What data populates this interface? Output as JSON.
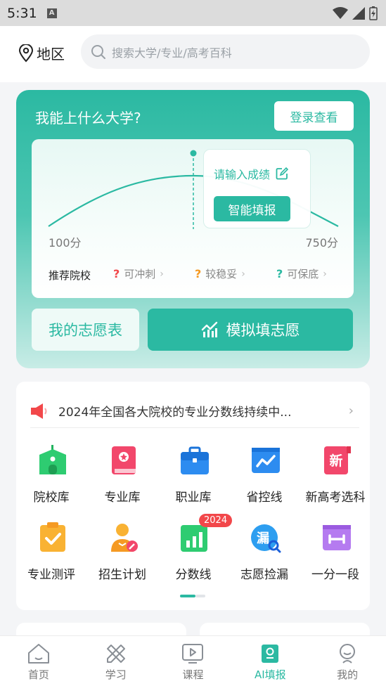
{
  "status_bar": {
    "time": "5:31",
    "notif_letter": "A"
  },
  "header": {
    "region_label": "地区",
    "search_placeholder": "搜索大学/专业/高考百科"
  },
  "hero": {
    "title": "我能上什么大学?",
    "login_label": "登录查看",
    "score_min": "100分",
    "score_max": "750分",
    "popup_prompt": "请输入成绩",
    "popup_button": "智能填报",
    "recommend_label": "推荐院校",
    "recommend_items": [
      {
        "label": "可冲刺",
        "color": "#f2474a"
      },
      {
        "label": "较稳妥",
        "color": "#f59a23"
      },
      {
        "label": "可保底",
        "color": "#2bb9a2"
      }
    ],
    "my_volunteer_label": "我的志愿表",
    "simulate_label": "模拟填志愿"
  },
  "notice": {
    "text": "2024年全国各大院校的专业分数线持续中..."
  },
  "tools": [
    {
      "label": "院校库",
      "icon": "school-icon"
    },
    {
      "label": "专业库",
      "icon": "major-book-icon"
    },
    {
      "label": "职业库",
      "icon": "briefcase-icon"
    },
    {
      "label": "省控线",
      "icon": "trend-line-icon"
    },
    {
      "label": "新高考选科",
      "icon": "new-gaokao-icon",
      "glyph": "新"
    },
    {
      "label": "专业测评",
      "icon": "test-clipboard-icon"
    },
    {
      "label": "招生计划",
      "icon": "enroll-plan-icon"
    },
    {
      "label": "分数线",
      "icon": "score-bars-icon",
      "badge": "2024"
    },
    {
      "label": "志愿捡漏",
      "icon": "volunteer-search-icon",
      "glyph": "漏"
    },
    {
      "label": "一分一段",
      "icon": "score-segment-icon"
    }
  ],
  "bottom_nav": [
    {
      "label": "首页",
      "icon": "home-icon",
      "active": false
    },
    {
      "label": "学习",
      "icon": "pencil-ruler-icon",
      "active": false
    },
    {
      "label": "课程",
      "icon": "video-icon",
      "active": false
    },
    {
      "label": "AI填报",
      "icon": "ai-fill-icon",
      "active": true
    },
    {
      "label": "我的",
      "icon": "profile-icon",
      "active": false
    }
  ],
  "colors": {
    "accent": "#2bb9a2",
    "danger": "#f2474a",
    "warn": "#f59a23"
  }
}
